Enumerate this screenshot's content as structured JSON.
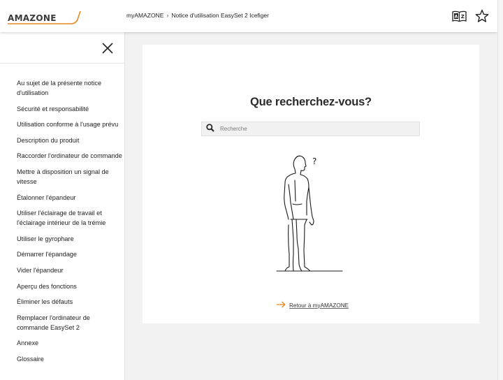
{
  "header": {
    "logo_text": "AMAZONE",
    "breadcrumb": [
      "myAMAZONE",
      "Notice d'utilisation EasySet 2 Icefiger"
    ],
    "breadcrumb_separator": "›",
    "icons": [
      "dictionary-icon",
      "star-icon"
    ]
  },
  "sidebar": {
    "items": [
      "Au sujet de la présente notice d'utilisation",
      "Sécurité et responsabilité",
      "Utilisation conforme à l'usage prévu",
      "Description du produit",
      "Raccorder l'ordinateur de commande",
      "Mettre à disposition un signal de vitesse",
      "Étalonner l'épandeur",
      "Utiliser l'éclairage de travail et l'éclairage intérieur de la trémie",
      "Utiliser le gyrophare",
      "Démarrer l'épandage",
      "Vider l'épandeur",
      "Aperçu des fonctions",
      "Éliminer les défauts",
      "Remplacer l'ordinateur de commande EasySet 2",
      "Annexe",
      "Glossaire"
    ]
  },
  "main": {
    "title": "Que recherchez-vous?",
    "search": {
      "placeholder": "Recherche",
      "value": ""
    },
    "illustration_mark": "?",
    "back_link": "Retour à myAMAZONE"
  },
  "colors": {
    "accent": "#e8891f",
    "text": "#222222",
    "background": "#f2f2f2"
  }
}
